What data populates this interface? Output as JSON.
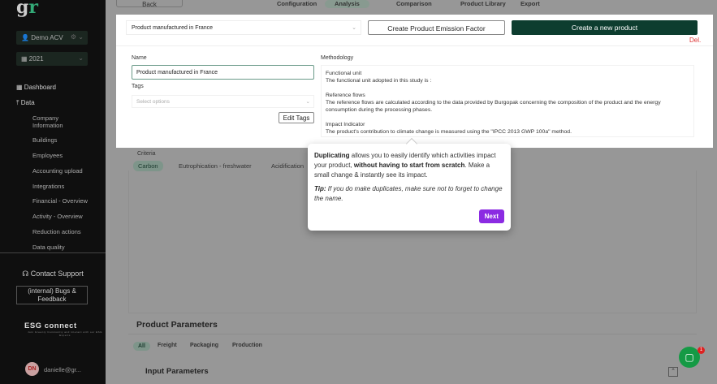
{
  "sidebar": {
    "logo": "gr",
    "workspace": "Demo ACV",
    "year": "2021",
    "dashboard": "Dashboard",
    "data": "Data",
    "items": [
      "Company Information",
      "Buildings",
      "Employees",
      "Accounting upload",
      "Integrations",
      "Financial - Overview",
      "Activity - Overview",
      "Reduction actions",
      "Data quality"
    ],
    "contact": "Contact Support",
    "bugs": "(internal) Bugs & Feedback",
    "esg": "ESG connect",
    "esg_sub": "Join Greenly Community and interact with our ESG Experts",
    "avatar": "DN",
    "user": "danielle@gr..."
  },
  "topbar": {
    "back": "Back",
    "tabs": [
      "Configuration",
      "Analysis",
      "Comparison",
      "Product Library",
      "Export"
    ],
    "active_tab": "Analysis"
  },
  "panel": {
    "product_select": "Product manufactured in France",
    "create_pef": "Create Product Emission Factor",
    "create_new": "Create a new product",
    "delete": "Del.",
    "name_label": "Name",
    "name_value": "Product manufactured in France",
    "tags_label": "Tags",
    "tags_placeholder": "Select options",
    "edit_tags": "Edit Tags",
    "methodology_label": "Methodology",
    "methodology": {
      "fu_title": "Functional unit",
      "fu_text": "The functional unit adopted in this study is :",
      "rf_title": "Reference flows",
      "rf_text": "The reference flows are calculated according to the data provided by Burgopak concerning the composition of the product and the energy consumption during the processing phases.",
      "ii_title": "Impact Indicator",
      "ii_text": "The product's contribution to climate change is measured using the \"IPCC 2013 GWP 100a\" method."
    }
  },
  "criteria": {
    "label": "Criteria",
    "chips": [
      "Carbon",
      "Eutrophication - freshwater",
      "Acidification"
    ]
  },
  "params": {
    "title": "Product Parameters",
    "tabs": [
      "All",
      "Freight",
      "Packaging",
      "Production"
    ],
    "input_title": "Input Parameters"
  },
  "chat": {
    "badge": "1"
  },
  "tooltip": {
    "b1": "Duplicating",
    "t1": " allows you to easily identify which activities impact your product, ",
    "b2": "without having to start from scratch",
    "t2": ". Make a small change & instantly see its impact.",
    "tip_b": "Tip:",
    "tip": " If you do make duplicates, make sure not to forget to change the name.",
    "next": "Next"
  }
}
